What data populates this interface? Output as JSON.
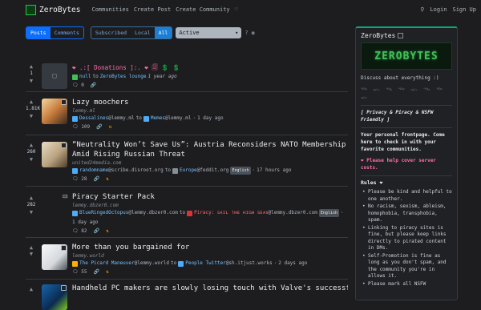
{
  "app": {
    "brand": "ZeroBytes",
    "nav": [
      "Communities",
      "Create Post",
      "Create Community"
    ],
    "login": "Login",
    "signup": "Sign Up"
  },
  "filters": {
    "type": [
      "Posts",
      "Comments"
    ],
    "listing": [
      "Subscribed",
      "Local",
      "All"
    ],
    "sort": "Active"
  },
  "posts": [
    {
      "score": "1",
      "title": "❤ .:[ Donations ]:. ❤ 🗐 💲 💲",
      "user": "null",
      "community": "ZeroBytes lounge",
      "age": "1 year ago",
      "comments": "0"
    },
    {
      "score": "1.81K",
      "title": "Lazy moochers",
      "domain": "lemmy.ml",
      "user": "Dessalines",
      "user_inst": "@lemmy.ml",
      "community": "Memes",
      "comm_inst": "@lemmy.ml",
      "age": "1 day ago",
      "comments": "109"
    },
    {
      "score": "260",
      "title": "“Neutrality Won’t Save Us”: Austria Reconsiders NATO Membership Amid Rising Russian Threat",
      "domain": "united24media.com",
      "user": "randomname",
      "user_inst": "@scribe.disroot.org",
      "community": "Europe",
      "comm_inst": "@feddit.org",
      "lang": "English",
      "age": "17 hours ago",
      "comments": "28"
    },
    {
      "score": "282",
      "title": "Piracy Starter Pack",
      "domain": "lemmy.dbzer0.com",
      "user": "BlueRingedOctopus",
      "user_inst": "@lemmy.dbzer0.com",
      "community": "Piracy: ꜱᴀɪʟ ᴛʜᴇ ʜɪɢʜ ꜱᴇᴀꜱ",
      "comm_inst": "@lemmy.dbzer0.com",
      "lang": "English",
      "age": "1 day ago",
      "comments": "82"
    },
    {
      "score": "",
      "title": "More than you bargained for",
      "domain": "lemmy.world",
      "user": "The Picard Maneuver",
      "user_inst": "@lemmy.world",
      "community": "People Twitter",
      "comm_inst": "@sh.itjust.works",
      "age": "2 days ago",
      "comments": "55"
    },
    {
      "score": "",
      "title": "Handheld PC makers are slowly losing touch with Valve's successful"
    }
  ],
  "sidebar": {
    "title": "ZeroBytes",
    "banner": "ZEROBYTES",
    "tagline": "Discuss about everything :)",
    "glyphs": "𓆝 𓆟 𓆞 𓆝 𓆟 𓆞 𓆝 𓆟",
    "privacy": "[ Privacy & Piracy & NSFW Friendly ]",
    "frontpage": "Your personal frontpage. Come here to check in with your favorite communities.",
    "donate": "❤ Please help cover server costs.",
    "rules_title": "Rules ❤",
    "rules": [
      "Please be kind and helpful to one another.",
      "No racism, sexism, ableism, homophobia, transphobia, spam.",
      "Linking to piracy sites is fine, but please keep links directly to pirated content in DMs.",
      "Self-Promotion is fine as long as you don't spam, and the community you're in allows it.",
      "Please mark all NSFW"
    ]
  }
}
